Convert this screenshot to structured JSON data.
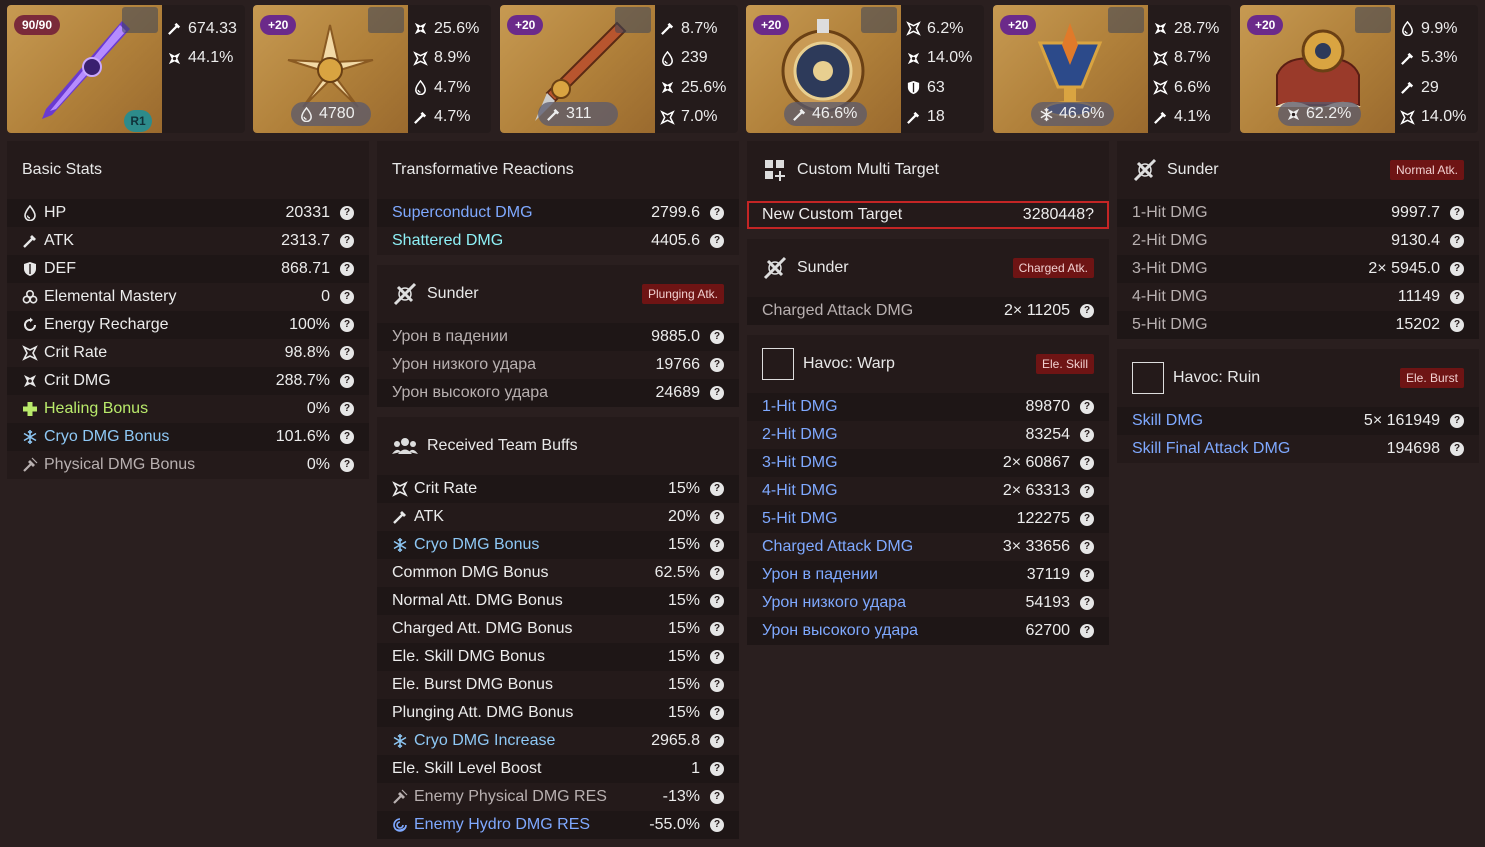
{
  "equipment": [
    {
      "level": "90/90",
      "refine": "R1",
      "main": null,
      "subs": [
        {
          "icon": "atk-icon",
          "value": "674.33"
        },
        {
          "icon": "crit-dmg-icon",
          "value": "44.1%"
        }
      ]
    },
    {
      "level": "+20",
      "main": {
        "icon": "hp-icon",
        "value": "4780"
      },
      "subs": [
        {
          "icon": "crit-dmg-icon",
          "value": "25.6%"
        },
        {
          "icon": "crit-rate-icon",
          "value": "8.9%"
        },
        {
          "icon": "hp-icon",
          "value": "4.7%"
        },
        {
          "icon": "atk-icon",
          "value": "4.7%"
        }
      ]
    },
    {
      "level": "+20",
      "main": {
        "icon": "atk-icon",
        "value": "311"
      },
      "subs": [
        {
          "icon": "atk-icon",
          "value": "8.7%"
        },
        {
          "icon": "hp-icon",
          "value": "239"
        },
        {
          "icon": "crit-dmg-icon",
          "value": "25.6%"
        },
        {
          "icon": "crit-rate-icon",
          "value": "7.0%"
        }
      ]
    },
    {
      "level": "+20",
      "main": {
        "icon": "atk-icon",
        "value": "46.6%"
      },
      "subs": [
        {
          "icon": "crit-rate-icon",
          "value": "6.2%"
        },
        {
          "icon": "crit-dmg-icon",
          "value": "14.0%"
        },
        {
          "icon": "def-icon",
          "value": "63"
        },
        {
          "icon": "atk-icon",
          "value": "18"
        }
      ]
    },
    {
      "level": "+20",
      "main": {
        "icon": "cryo-icon",
        "value": "46.6%"
      },
      "subs": [
        {
          "icon": "crit-dmg-icon",
          "value": "28.7%"
        },
        {
          "icon": "crit-rate-icon",
          "value": "8.7%"
        },
        {
          "icon": "crit-rate-icon",
          "value": "6.6%"
        },
        {
          "icon": "atk-icon",
          "value": "4.1%"
        }
      ]
    },
    {
      "level": "+20",
      "main": {
        "icon": "crit-dmg-icon",
        "value": "62.2%"
      },
      "subs": [
        {
          "icon": "hp-icon",
          "value": "9.9%"
        },
        {
          "icon": "atk-icon",
          "value": "5.3%"
        },
        {
          "icon": "atk-icon",
          "value": "29"
        },
        {
          "icon": "crit-rate-icon",
          "value": "14.0%"
        }
      ]
    }
  ],
  "basic_stats": {
    "title": "Basic Stats",
    "rows": [
      {
        "icon": "hp-icon",
        "label": "HP",
        "value": "20331",
        "color": ""
      },
      {
        "icon": "atk-icon",
        "label": "ATK",
        "value": "2313.7",
        "color": ""
      },
      {
        "icon": "def-icon",
        "label": "DEF",
        "value": "868.71",
        "color": ""
      },
      {
        "icon": "em-icon",
        "label": "Elemental Mastery",
        "value": "0",
        "color": ""
      },
      {
        "icon": "er-icon",
        "label": "Energy Recharge",
        "value": "100%",
        "color": ""
      },
      {
        "icon": "crit-rate-icon",
        "label": "Crit Rate",
        "value": "98.8%",
        "color": ""
      },
      {
        "icon": "crit-dmg-icon",
        "label": "Crit DMG",
        "value": "288.7%",
        "color": ""
      },
      {
        "icon": "heal-icon",
        "label": "Healing Bonus",
        "value": "0%",
        "color": "green"
      },
      {
        "icon": "cryo-icon",
        "label": "Cryo DMG Bonus",
        "value": "101.6%",
        "color": "cryo"
      },
      {
        "icon": "physical-icon",
        "label": "Physical DMG Bonus",
        "value": "0%",
        "color": "dim"
      }
    ]
  },
  "transformative": {
    "title": "Transformative Reactions",
    "rows": [
      {
        "label": "Superconduct DMG",
        "value": "2799.6",
        "color": "blue"
      },
      {
        "label": "Shattered DMG",
        "value": "4405.6",
        "color": "teal"
      }
    ]
  },
  "sunder_plunge": {
    "title": "Sunder",
    "badge": "Plunging Atk.",
    "rows": [
      {
        "label": "Урон в падении",
        "value": "9885.0"
      },
      {
        "label": "Урон низкого удара",
        "value": "19766"
      },
      {
        "label": "Урон высокого удара",
        "value": "24689"
      }
    ]
  },
  "team_buffs": {
    "title": "Received Team Buffs",
    "rows": [
      {
        "icon": "crit-rate-icon",
        "label": "Crit Rate",
        "value": "15%",
        "color": ""
      },
      {
        "icon": "atk-icon",
        "label": "ATK",
        "value": "20%",
        "color": ""
      },
      {
        "icon": "cryo-icon",
        "label": "Cryo DMG Bonus",
        "value": "15%",
        "color": "cryo"
      },
      {
        "icon": "",
        "label": "Common DMG Bonus",
        "value": "62.5%",
        "color": ""
      },
      {
        "icon": "",
        "label": "Normal Att. DMG Bonus",
        "value": "15%",
        "color": ""
      },
      {
        "icon": "",
        "label": "Charged Att. DMG Bonus",
        "value": "15%",
        "color": ""
      },
      {
        "icon": "",
        "label": "Ele. Skill DMG Bonus",
        "value": "15%",
        "color": ""
      },
      {
        "icon": "",
        "label": "Ele. Burst DMG Bonus",
        "value": "15%",
        "color": ""
      },
      {
        "icon": "",
        "label": "Plunging Att. DMG Bonus",
        "value": "15%",
        "color": ""
      },
      {
        "icon": "cryo-icon",
        "label": "Cryo DMG Increase",
        "value": "2965.8",
        "color": "cryo"
      },
      {
        "icon": "",
        "label": "Ele. Skill Level Boost",
        "value": "1",
        "color": ""
      },
      {
        "icon": "physical-icon",
        "label": "Enemy Physical DMG RES",
        "value": "-13%",
        "color": "dim"
      },
      {
        "icon": "hydro-icon",
        "label": "Enemy Hydro DMG RES",
        "value": "-55.0%",
        "color": "blue"
      }
    ]
  },
  "custom_target": {
    "title": "Custom Multi Target",
    "label": "New Custom Target",
    "value": "3280448"
  },
  "sunder_charged": {
    "title": "Sunder",
    "badge": "Charged Atk.",
    "rows": [
      {
        "label": "Charged Attack DMG",
        "value": "2× 11205"
      }
    ]
  },
  "havoc_warp": {
    "title": "Havoc: Warp",
    "badge": "Ele. Skill",
    "rows": [
      {
        "label": "1-Hit DMG",
        "value": "89870"
      },
      {
        "label": "2-Hit DMG",
        "value": "83254"
      },
      {
        "label": "3-Hit DMG",
        "value": "2× 60867"
      },
      {
        "label": "4-Hit DMG",
        "value": "2× 63313"
      },
      {
        "label": "5-Hit DMG",
        "value": "122275"
      },
      {
        "label": "Charged Attack DMG",
        "value": "3× 33656"
      },
      {
        "label": "Урон в падении",
        "value": "37119"
      },
      {
        "label": "Урон низкого удара",
        "value": "54193"
      },
      {
        "label": "Урон высокого удара",
        "value": "62700"
      }
    ]
  },
  "sunder_normal": {
    "title": "Sunder",
    "badge": "Normal Atk.",
    "rows": [
      {
        "label": "1-Hit DMG",
        "value": "9997.7"
      },
      {
        "label": "2-Hit DMG",
        "value": "9130.4"
      },
      {
        "label": "3-Hit DMG",
        "value": "2× 5945.0"
      },
      {
        "label": "4-Hit DMG",
        "value": "11149"
      },
      {
        "label": "5-Hit DMG",
        "value": "15202"
      }
    ]
  },
  "havoc_ruin": {
    "title": "Havoc: Ruin",
    "badge": "Ele. Burst",
    "rows": [
      {
        "label": "Skill DMG",
        "value": "5× 161949"
      },
      {
        "label": "Skill Final Attack DMG",
        "value": "194698"
      }
    ]
  },
  "help_glyph": "?"
}
